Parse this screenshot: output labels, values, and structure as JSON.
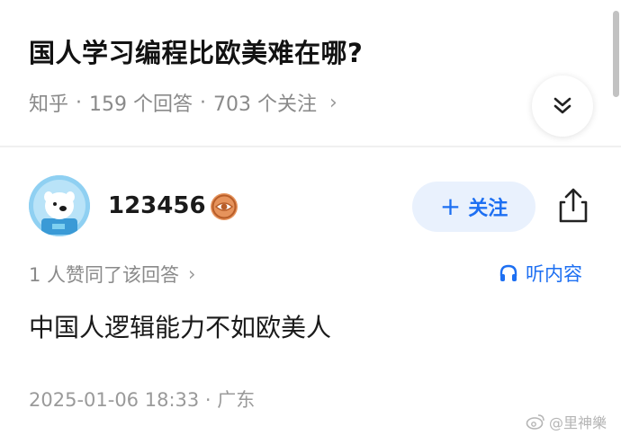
{
  "question": {
    "title": "国人学习编程比欧美难在哪?",
    "source": "知乎",
    "answers_count": "159 个回答",
    "followers_count": "703 个关注",
    "chevron_icon": "chevron-right-icon",
    "collapse_icon": "double-chevron-down-icon"
  },
  "answer": {
    "author_name": "123456",
    "badge_icon": "eye-medal-icon",
    "follow_label": "关注",
    "follow_plus": "+",
    "share_icon": "share-icon",
    "approve_text": "1 人赞同了该回答",
    "listen_label": "听内容",
    "listen_icon": "headphones-icon",
    "content": "中国人逻辑能力不如欧美人",
    "timestamp": "2025-01-06 18:33 · 广东"
  },
  "watermark": {
    "text": "@里神樂",
    "icon": "weibo-icon"
  },
  "colors": {
    "accent": "#1d6ff2",
    "follow_bg": "#e9f1fd",
    "meta_gray": "#8a8a8a",
    "badge_orange": "#d9783a",
    "avatar_blue": "#8fd0f2"
  }
}
